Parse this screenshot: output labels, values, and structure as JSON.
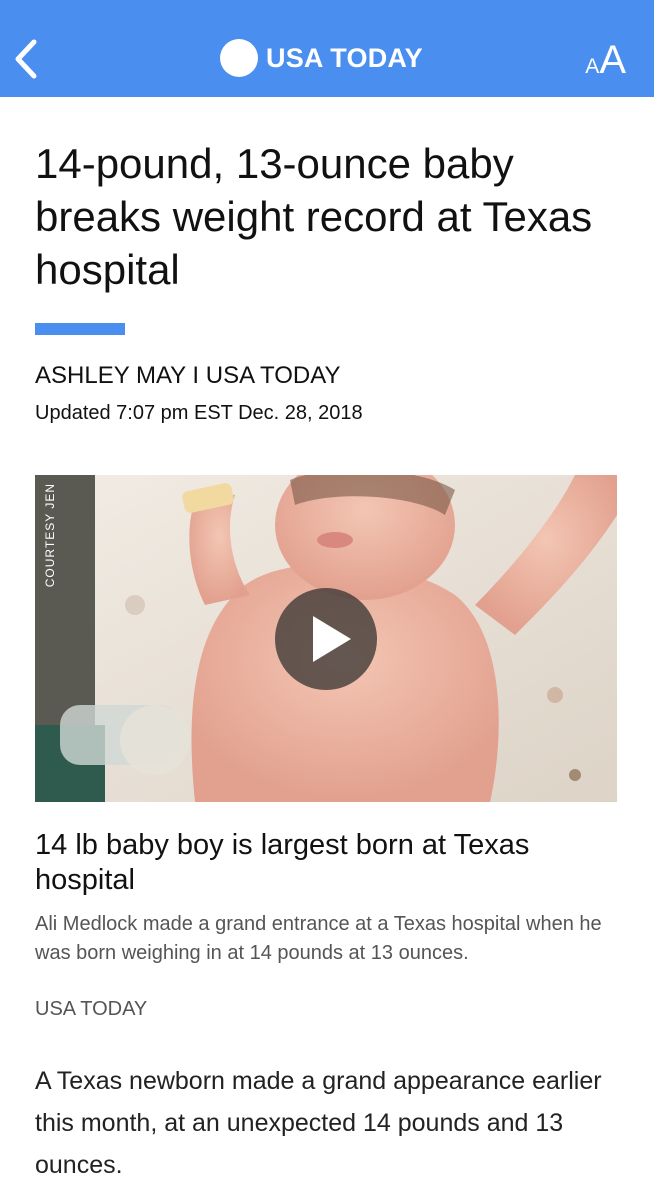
{
  "header": {
    "logo_text": "USA TODAY",
    "text_size_small": "A",
    "text_size_large": "A",
    "bar_color": "#4a8ef0"
  },
  "article": {
    "headline": "14-pound, 13-ounce baby breaks weight record at Texas hospital",
    "byline": "ASHLEY MAY I USA TODAY",
    "updated": "Updated 7:07 pm EST Dec. 28, 2018",
    "accent_color": "#4a8ef0"
  },
  "video": {
    "credit": "COURTESY JEN",
    "caption_title": "14 lb baby boy is largest born at Texas hospital",
    "caption_description": "Ali Medlock made a grand entrance at a Texas hospital when he was born weighing in at 14 pounds at 13 ounces.",
    "caption_source": "USA TODAY",
    "play_icon": "play-icon"
  },
  "body": {
    "paragraph_1": "A Texas newborn made a grand appearance earlier this month, at an unexpected 14 pounds and 13 ounces."
  }
}
